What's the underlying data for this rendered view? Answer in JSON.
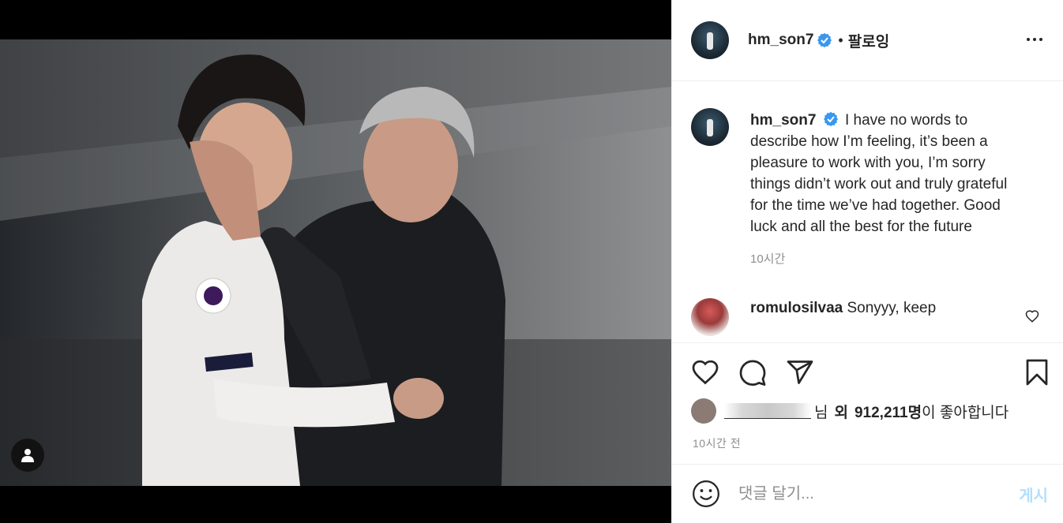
{
  "post": {
    "author": "hm_son7",
    "follow_separator": "•",
    "follow_label": "팔로잉",
    "caption": "I have no words to describe how I’m feeling, it’s been a pleasure to work with you, I’m sorry things didn’t work out and truly grateful for the time we’ve had together. Good luck and all the best for the future",
    "caption_time": "10시간",
    "comments": [
      {
        "username": "romulosilvaa",
        "text": "Sonyyy, keep"
      }
    ],
    "likes": {
      "name_suffix": "님",
      "and_label": "외",
      "count": "912,211명",
      "liked_text": "이 좋아합니다"
    },
    "date": "10시간 전",
    "comment_placeholder": "댓글 달기...",
    "post_button": "게시"
  },
  "colors": {
    "verified": "#3897f0",
    "post_button": "#b2dffc",
    "muted_text": "#8e8e8e"
  },
  "icons": [
    "verified-badge-icon",
    "more-options-icon",
    "heart-icon",
    "comment-icon",
    "share-icon",
    "bookmark-icon",
    "user-tag-icon",
    "emoji-icon"
  ]
}
